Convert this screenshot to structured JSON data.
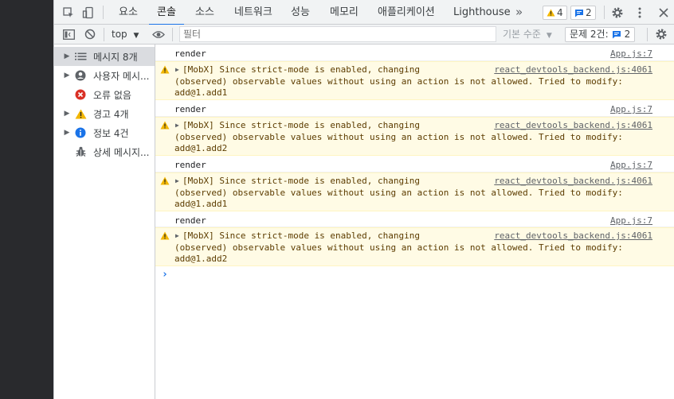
{
  "tabs": [
    {
      "label": "요소"
    },
    {
      "label": "콘솔"
    },
    {
      "label": "소스"
    },
    {
      "label": "네트워크"
    },
    {
      "label": "성능"
    },
    {
      "label": "메모리"
    },
    {
      "label": "애플리케이션"
    },
    {
      "label": "Lighthouse"
    }
  ],
  "header": {
    "more_tabs": "»",
    "warnings_count": "4",
    "info_count": "2"
  },
  "toolbar": {
    "context": "top",
    "filter_placeholder": "필터",
    "levels": "기본 수준",
    "issues_label": "문제 2건:",
    "issues_count": "2"
  },
  "sidebar": {
    "items": [
      {
        "label": "메시지 8개"
      },
      {
        "label": "사용자 메시..."
      },
      {
        "label": "오류 없음"
      },
      {
        "label": "경고 4개"
      },
      {
        "label": "정보 4건"
      },
      {
        "label": "상세 메시지..."
      }
    ]
  },
  "console": {
    "entries": [
      {
        "log": "render",
        "log_src": "App.js:7",
        "warn_l1": "[MobX] Since strict-mode is enabled, changing",
        "warn_l2": "(observed) observable values without using an action is not allowed. Tried to modify:",
        "warn_l3": "add@1.add1",
        "warn_src": "react_devtools_backend.js:4061"
      },
      {
        "log": "render",
        "log_src": "App.js:7",
        "warn_l1": "[MobX] Since strict-mode is enabled, changing",
        "warn_l2": "(observed) observable values without using an action is not allowed. Tried to modify:",
        "warn_l3": "add@1.add2",
        "warn_src": "react_devtools_backend.js:4061"
      },
      {
        "log": "render",
        "log_src": "App.js:7",
        "warn_l1": "[MobX] Since strict-mode is enabled, changing",
        "warn_l2": "(observed) observable values without using an action is not allowed. Tried to modify:",
        "warn_l3": "add@1.add1",
        "warn_src": "react_devtools_backend.js:4061"
      },
      {
        "log": "render",
        "log_src": "App.js:7",
        "warn_l1": "[MobX] Since strict-mode is enabled, changing",
        "warn_l2": "(observed) observable values without using an action is not allowed. Tried to modify:",
        "warn_l3": "add@1.add2",
        "warn_src": "react_devtools_backend.js:4061"
      }
    ],
    "prompt": "›"
  },
  "colors": {
    "accent": "#1a73e8",
    "warning_bg": "#fffbe5",
    "warning_icon": "#f2b600",
    "error_icon": "#d93025",
    "dark_panel": "#292a2d"
  }
}
